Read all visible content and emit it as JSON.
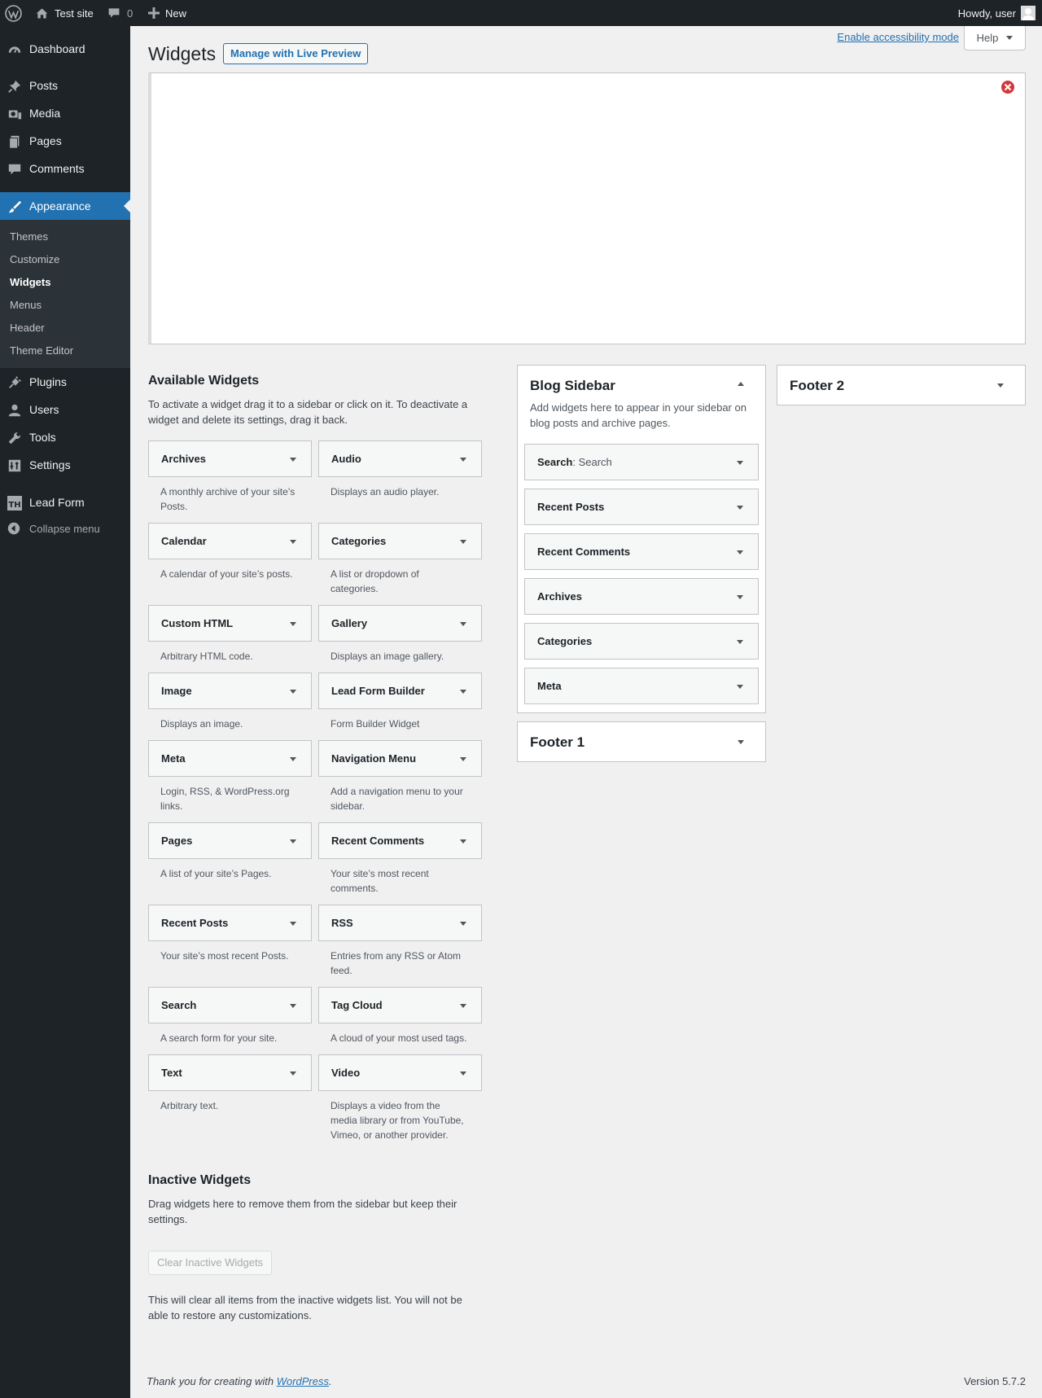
{
  "adminbar": {
    "site_name": "Test site",
    "comments_count": "0",
    "new_label": "New",
    "howdy": "Howdy, user"
  },
  "menu": {
    "dashboard": "Dashboard",
    "posts": "Posts",
    "media": "Media",
    "pages": "Pages",
    "comments": "Comments",
    "appearance": "Appearance",
    "plugins": "Plugins",
    "users": "Users",
    "tools": "Tools",
    "settings": "Settings",
    "lead_form": "Lead Form",
    "collapse": "Collapse menu",
    "submenu": [
      "Themes",
      "Customize",
      "Widgets",
      "Menus",
      "Header",
      "Theme Editor"
    ]
  },
  "header": {
    "title": "Widgets",
    "live_preview": "Manage with Live Preview",
    "a11y_link": "Enable accessibility mode",
    "help": "Help"
  },
  "available": {
    "title": "Available Widgets",
    "description": "To activate a widget drag it to a sidebar or click on it. To deactivate a widget and delete its settings, drag it back.",
    "widgets": [
      {
        "title": "Archives",
        "desc": "A monthly archive of your site’s Posts."
      },
      {
        "title": "Audio",
        "desc": "Displays an audio player."
      },
      {
        "title": "Calendar",
        "desc": "A calendar of your site’s posts."
      },
      {
        "title": "Categories",
        "desc": "A list or dropdown of categories."
      },
      {
        "title": "Custom HTML",
        "desc": "Arbitrary HTML code."
      },
      {
        "title": "Gallery",
        "desc": "Displays an image gallery."
      },
      {
        "title": "Image",
        "desc": "Displays an image."
      },
      {
        "title": "Lead Form Builder",
        "desc": "Form Builder Widget"
      },
      {
        "title": "Meta",
        "desc": "Login, RSS, & WordPress.org links."
      },
      {
        "title": "Navigation Menu",
        "desc": "Add a navigation menu to your sidebar."
      },
      {
        "title": "Pages",
        "desc": "A list of your site’s Pages."
      },
      {
        "title": "Recent Comments",
        "desc": "Your site’s most recent comments."
      },
      {
        "title": "Recent Posts",
        "desc": "Your site’s most recent Posts."
      },
      {
        "title": "RSS",
        "desc": "Entries from any RSS or Atom feed."
      },
      {
        "title": "Search",
        "desc": "A search form for your site."
      },
      {
        "title": "Tag Cloud",
        "desc": "A cloud of your most used tags."
      },
      {
        "title": "Text",
        "desc": "Arbitrary text."
      },
      {
        "title": "Video",
        "desc": "Displays a video from the media library or from YouTube, Vimeo, or another provider."
      }
    ]
  },
  "blog_sidebar": {
    "title": "Blog Sidebar",
    "description": "Add widgets here to appear in your sidebar on blog posts and archive pages.",
    "widgets": [
      {
        "title": "Search",
        "subtitle": ": Search"
      },
      {
        "title": "Recent Posts",
        "subtitle": ""
      },
      {
        "title": "Recent Comments",
        "subtitle": ""
      },
      {
        "title": "Archives",
        "subtitle": ""
      },
      {
        "title": "Categories",
        "subtitle": ""
      },
      {
        "title": "Meta",
        "subtitle": ""
      }
    ]
  },
  "footer1": {
    "title": "Footer 1"
  },
  "footer2": {
    "title": "Footer 2"
  },
  "inactive": {
    "title": "Inactive Widgets",
    "description": "Drag widgets here to remove them from the sidebar but keep their settings.",
    "clear_button": "Clear Inactive Widgets",
    "clear_note": "This will clear all items from the inactive widgets list. You will not be able to restore any customizations."
  },
  "footer": {
    "thanks_prefix": "Thank you for creating with ",
    "wp_link": "WordPress",
    "thanks_suffix": ".",
    "version": "Version 5.7.2"
  }
}
